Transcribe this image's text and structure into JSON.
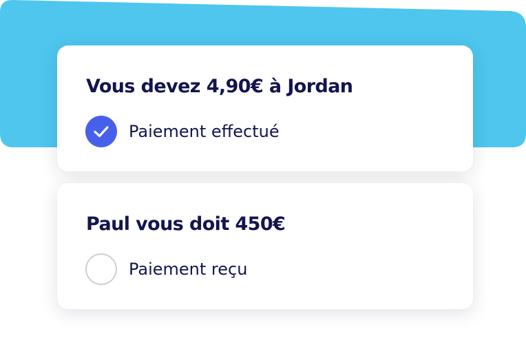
{
  "colors": {
    "background_accent": "#4ec6ee",
    "title_text": "#14144f",
    "check_fill": "#4760ec",
    "card_bg": "#ffffff"
  },
  "cards": [
    {
      "title": "Vous devez 4,90€ à Jordan",
      "status_label": "Paiement effectué",
      "checked": true,
      "icon": "check-icon"
    },
    {
      "title": "Paul vous doit 450€",
      "status_label": "Paiement reçu",
      "checked": false,
      "icon": "empty-circle-icon"
    }
  ]
}
